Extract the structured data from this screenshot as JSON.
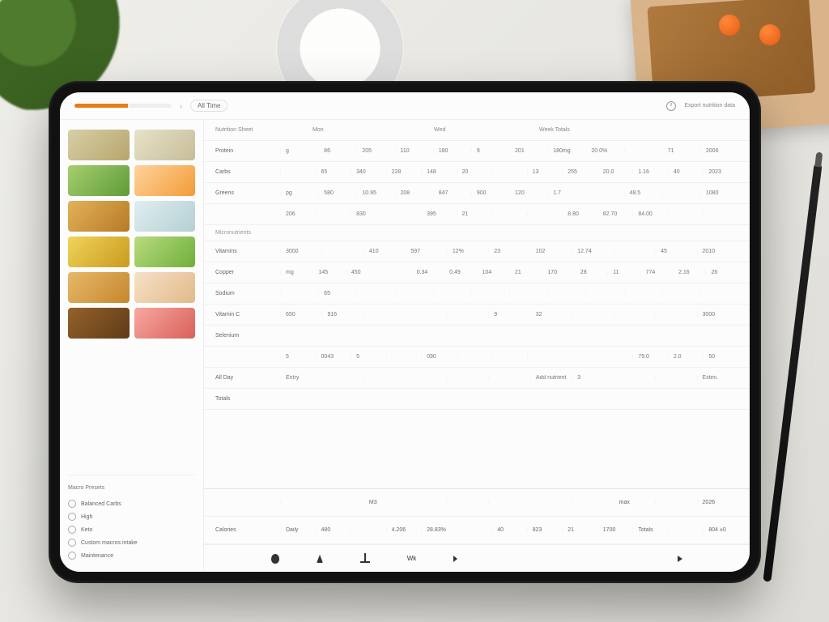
{
  "header": {
    "progress_pct": 55,
    "tab_label": "All Time",
    "right_link": "Export nutrition data"
  },
  "sidebar": {
    "bottom_heading": "Macro Presets",
    "menu": [
      {
        "label": "Balanced Carbs"
      },
      {
        "label": "High"
      },
      {
        "label": "Keto"
      },
      {
        "label": "Custom macros intake"
      },
      {
        "label": "Maintenance"
      }
    ]
  },
  "table": {
    "headers": {
      "c1": "Nutrition Sheet",
      "c2": "Mon",
      "c3": "Wed",
      "c4": "Week Totals"
    },
    "rows": [
      {
        "label": "Protein",
        "cells": [
          "g",
          "86",
          "205",
          "110",
          "180",
          "9",
          "201",
          "180mg",
          "20.0%",
          "",
          "71",
          "2006"
        ]
      },
      {
        "label": "Carbs",
        "cells": [
          "",
          "65",
          "340",
          "228",
          "148",
          "20",
          "",
          "13",
          "255",
          "20.0",
          "1.16",
          "40",
          "2023"
        ]
      },
      {
        "label": "Greens",
        "cells": [
          "pg",
          "580",
          "10.95",
          "208",
          "847",
          "900",
          "120",
          "1.7",
          "",
          "48.5",
          "",
          "1080"
        ]
      },
      {
        "label": "",
        "cells": [
          "206",
          "",
          "830",
          "",
          "395",
          "21",
          "",
          "",
          "8.80",
          "82.70",
          "84.00",
          "",
          ""
        ]
      },
      {
        "section": "Micronutrients"
      },
      {
        "label": "Vitamins",
        "cells": [
          "3000",
          "",
          "410",
          "597",
          "12%",
          "23",
          "102",
          "12.74",
          "",
          "45",
          "2010"
        ]
      },
      {
        "label": "Copper",
        "cells": [
          "mg",
          "145",
          "450",
          "",
          "0.34",
          "0.49",
          "104",
          "21",
          "170",
          "28",
          "11",
          "774",
          "2.16",
          "26"
        ]
      },
      {
        "label": "Sodium",
        "cells": [
          "",
          "65",
          "",
          "",
          "",
          "",
          "",
          "",
          "",
          "",
          "",
          ""
        ]
      },
      {
        "label": "Vitamin C",
        "cells": [
          "650",
          "916",
          "",
          "",
          "",
          "9",
          "32",
          "",
          "",
          "",
          "3000"
        ]
      },
      {
        "label": "Selenium",
        "cells": [
          "",
          "",
          "",
          "",
          "",
          "",
          "",
          "",
          "",
          "",
          ""
        ]
      },
      {
        "label": "",
        "cells": [
          "5",
          "0043",
          "5",
          "",
          "090",
          "",
          "",
          "",
          "",
          "",
          "79.0",
          "2.0",
          "50"
        ]
      },
      {
        "label": "All Day",
        "cells": [
          "Entry",
          "",
          "",
          "",
          "",
          "",
          "Add nutrient",
          "3",
          "",
          "",
          "Estim."
        ]
      },
      {
        "label": "Totals",
        "cells": [
          "",
          "",
          "",
          "",
          "",
          "",
          "",
          "",
          "",
          "",
          ""
        ]
      }
    ],
    "summary_rows": [
      {
        "label": "",
        "cells": [
          "",
          "",
          "M3",
          "",
          "",
          "",
          "",
          "",
          "max",
          "",
          "2026"
        ]
      },
      {
        "label": "Calories",
        "cells": [
          "Daily",
          "480",
          "",
          "4.206",
          "28.83%",
          "",
          "40",
          "823",
          "21",
          "1700",
          "Totals",
          "",
          "804 ±0"
        ]
      }
    ]
  },
  "bottombar": {
    "label_mid": "Wk"
  }
}
